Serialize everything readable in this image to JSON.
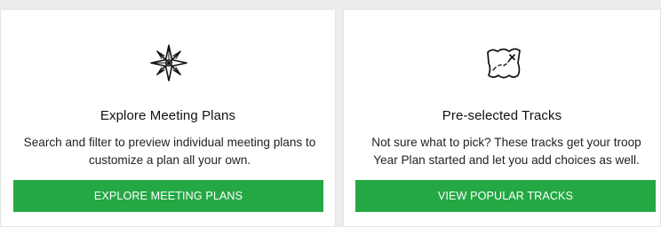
{
  "cards": [
    {
      "icon": "compass-rose-icon",
      "title": "Explore Meeting Plans",
      "description_line1": "Search and filter to preview individual meeting plans to",
      "description_line2": "customize a plan all your own.",
      "button_label": "EXPLORE MEETING PLANS"
    },
    {
      "icon": "treasure-map-icon",
      "title": "Pre-selected Tracks",
      "description_line1": "Not sure what to pick? These tracks get your troop",
      "description_line2": "Year Plan started and let you add choices as well.",
      "button_label": "VIEW POPULAR TRACKS"
    }
  ],
  "colors": {
    "button_green": "#24a844",
    "background": "#ececec",
    "card": "#ffffff"
  }
}
